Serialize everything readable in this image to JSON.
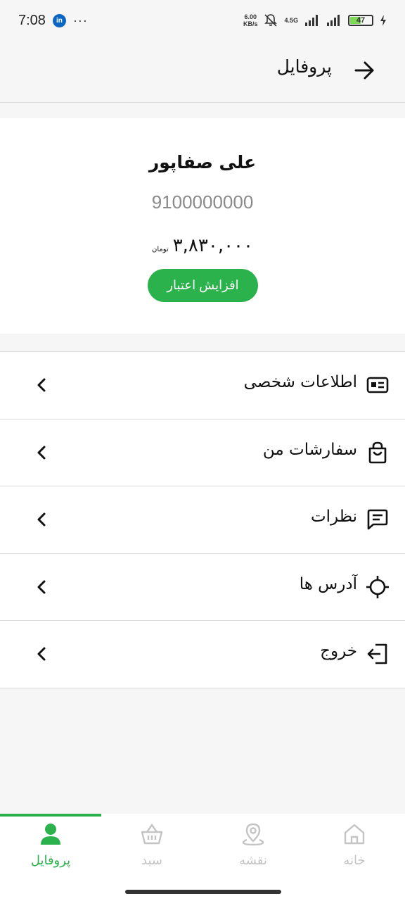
{
  "status": {
    "time": "7:08",
    "linkedin": "in",
    "dots": "···",
    "net_speed_value": "6.00",
    "net_speed_unit": "KB/s",
    "network": "4.5G",
    "battery": "47"
  },
  "header": {
    "title": "پروفایل"
  },
  "profile": {
    "name": "علی صفاپور",
    "phone": "9100000000",
    "balance": "۳,۸۳۰,۰۰۰",
    "currency": "تومان",
    "increase_button": "افزایش اعتبار"
  },
  "menu": {
    "items": [
      {
        "label": "اطلاعات شخصی",
        "icon": "id-card-icon"
      },
      {
        "label": "سفارشات من",
        "icon": "shopping-bag-icon"
      },
      {
        "label": "نظرات",
        "icon": "comment-icon"
      },
      {
        "label": "آدرس ها",
        "icon": "crosshair-icon"
      },
      {
        "label": "خروج",
        "icon": "logout-icon"
      }
    ]
  },
  "bottom_nav": {
    "items": [
      {
        "label": "پروفایل",
        "icon": "user-icon",
        "active": true
      },
      {
        "label": "سبد",
        "icon": "basket-icon",
        "active": false
      },
      {
        "label": "نقشه",
        "icon": "map-pin-icon",
        "active": false
      },
      {
        "label": "خانه",
        "icon": "home-icon",
        "active": false
      }
    ]
  },
  "colors": {
    "accent": "#2bb24c",
    "inactive": "#c4c4c4",
    "background": "#f6f6f6"
  }
}
